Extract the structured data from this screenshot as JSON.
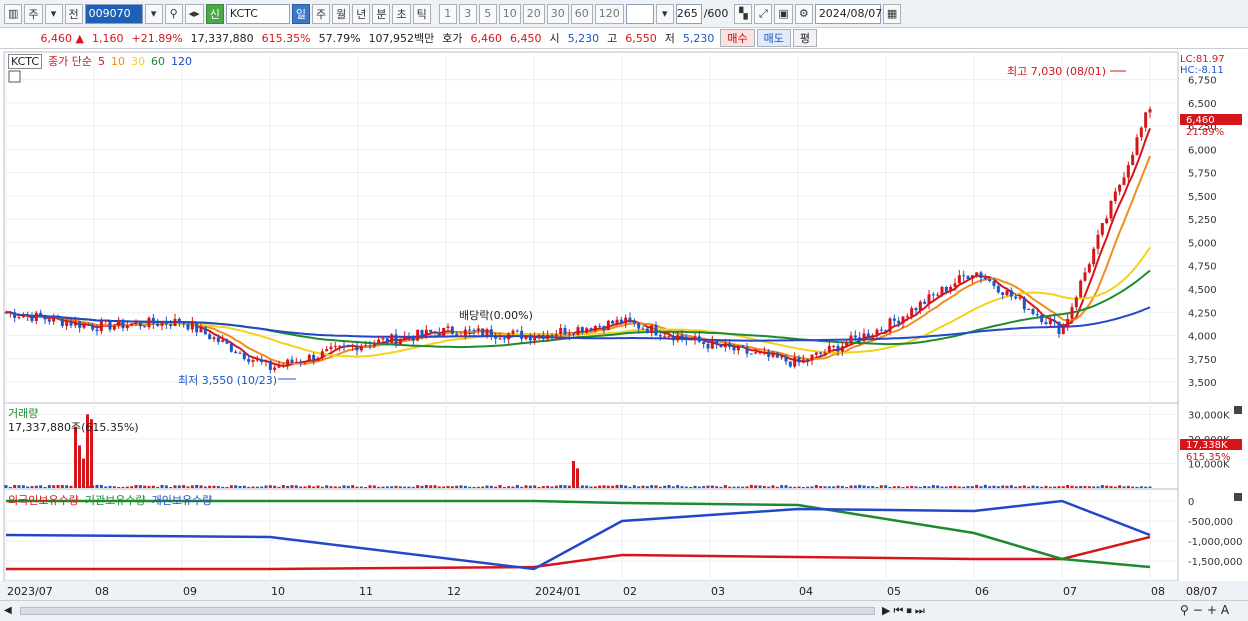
{
  "toolbar": {
    "period_buttons": [
      "주",
      "전"
    ],
    "code": "009070",
    "name_badge": "신",
    "name": "KCTC",
    "interval_buttons": [
      "일",
      "주",
      "월",
      "년",
      "분",
      "초",
      "틱"
    ],
    "tick_buttons": [
      "1",
      "3",
      "5",
      "10",
      "20",
      "30",
      "60",
      "120"
    ],
    "count": "265",
    "count_max": "/600",
    "date": "2024/08/07"
  },
  "quote": {
    "price": "6,460",
    "arrow": "▲",
    "change": "1,160",
    "change_pct": "+21.89%",
    "volume": "17,337,880",
    "volume_ratio": "615.35%",
    "turnover": "57.79%",
    "amount": "107,952백만",
    "hoga_label": "호가",
    "ask": "6,460",
    "bid": "6,450",
    "open_label": "시",
    "open": "5,230",
    "high_label": "고",
    "high": "6,550",
    "low_label": "저",
    "low": "5,230",
    "buy": "매수",
    "sell": "매도",
    "eval": "평"
  },
  "price_pane": {
    "symbol": "KCTC",
    "ma_label": "종가 단순",
    "ma_periods": [
      "5",
      "10",
      "30",
      "60",
      "120"
    ],
    "ma_colors": [
      "#d4161b",
      "#f28c1c",
      "#f2d21c",
      "#1c8a2f",
      "#2248c8"
    ],
    "lc": "LC:81.97",
    "hc": "HC:-8.11",
    "last_price": "6,460",
    "last_pct": "21.89%",
    "high_note": "최고 7,030 (08/01)",
    "low_note": "최저 3,550 (10/23)",
    "dividend_note": "배당락(0.00%)",
    "y_ticks": [
      "6,750",
      "6,500",
      "6,250",
      "6,000",
      "5,750",
      "5,500",
      "5,250",
      "5,000",
      "4,750",
      "4,500",
      "4,250",
      "4,000",
      "3,750",
      "3,500"
    ]
  },
  "volume_pane": {
    "title": "거래량",
    "value": "17,337,880주(615.35%)",
    "y_ticks": [
      "30,000K",
      "20,000K",
      "10,000K"
    ],
    "last_value": "17,338K",
    "last_pct": "615.35%"
  },
  "holding_pane": {
    "series": [
      {
        "name": "외국인보유수량",
        "color": "#d4161b"
      },
      {
        "name": "기관보유수량",
        "color": "#1c8a2f"
      },
      {
        "name": "개인보유수량",
        "color": "#2248c8"
      }
    ],
    "y_ticks": [
      "0",
      "-500,000",
      "-1,000,000",
      "-1,500,000"
    ]
  },
  "x_axis": {
    "labels": [
      "2023/07",
      "08",
      "09",
      "10",
      "11",
      "12",
      "2024/01",
      "02",
      "03",
      "04",
      "05",
      "06",
      "07",
      "08"
    ],
    "end_label": "08/07"
  },
  "chart_data": [
    {
      "type": "line",
      "title": "",
      "x": [
        "2023/07",
        "2023/08",
        "2023/09",
        "2023/10",
        "2023/11",
        "2023/12",
        "2024/01",
        "2024/02",
        "2024/03",
        "2024/04",
        "2024/05",
        "2024/06",
        "2024/07",
        "2024/08"
      ],
      "series": [
        {
          "name": "종가",
          "values": [
            4250,
            4100,
            4150,
            3650,
            3900,
            4050,
            4000,
            4150,
            3900,
            3700,
            4100,
            4700,
            4050,
            6460
          ]
        },
        {
          "name": "120",
          "values": [
            4300,
            4250,
            4200,
            4150,
            4100,
            4050,
            4000,
            4000,
            4000,
            4000,
            4000,
            4050,
            4100,
            4250
          ]
        }
      ],
      "ylim": [
        3350,
        6950
      ]
    },
    {
      "type": "bar",
      "title": "거래량",
      "x": [
        "2024/01",
        "2024/01",
        "2024/08",
        "2024/08",
        "2024/08",
        "2024/08",
        "2024/08"
      ],
      "values": [
        11000,
        8000,
        12000,
        30000,
        28000,
        25000,
        17338
      ],
      "ylim": [
        0,
        33000
      ]
    },
    {
      "type": "line",
      "x": [
        "2023/07",
        "2023/10",
        "2024/01",
        "2024/02",
        "2024/04",
        "2024/06",
        "2024/07",
        "2024/08"
      ],
      "series": [
        {
          "name": "외국인보유수량",
          "values": [
            -1700000,
            -1700000,
            -1650000,
            -1350000,
            -1400000,
            -1450000,
            -1450000,
            -900000
          ]
        },
        {
          "name": "기관보유수량",
          "values": [
            0,
            0,
            0,
            -50000,
            -100000,
            -800000,
            -1450000,
            -1650000
          ]
        },
        {
          "name": "개인보유수량",
          "values": [
            -850000,
            -900000,
            -1700000,
            -500000,
            -200000,
            -250000,
            0,
            -850000
          ]
        }
      ]
    }
  ]
}
